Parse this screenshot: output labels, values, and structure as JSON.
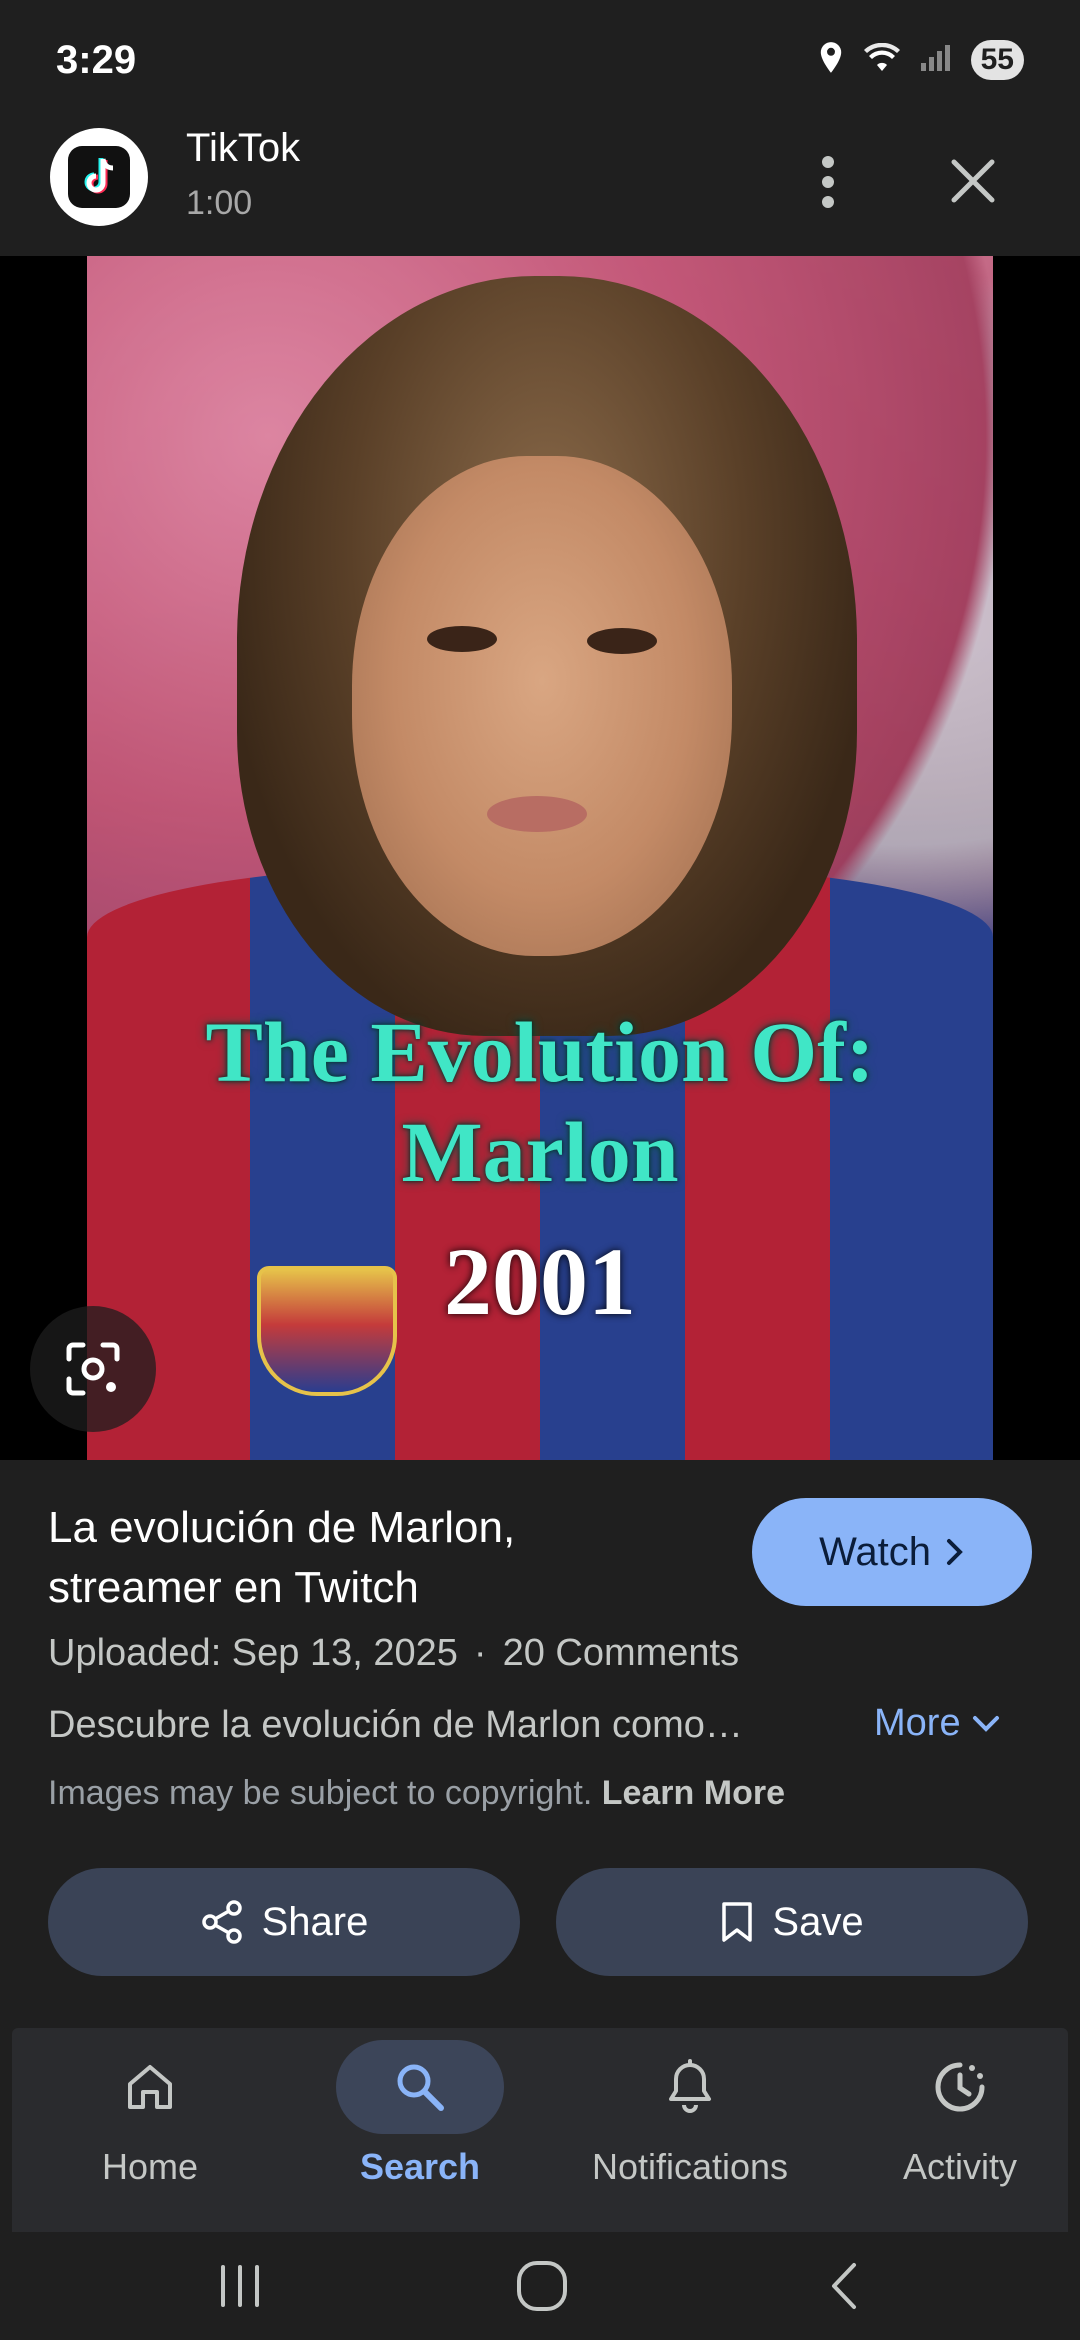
{
  "status_bar": {
    "time": "3:29",
    "battery": "55"
  },
  "header": {
    "source_name": "TikTok",
    "duration": "1:00"
  },
  "thumbnail": {
    "overlay_title_line1": "The Evolution Of:",
    "overlay_title_line2": "Marlon",
    "overlay_year": "2001"
  },
  "result": {
    "title": "La evolución de Marlon, streamer en Twitch",
    "watch_label": "Watch",
    "uploaded": "Uploaded: Sep 13, 2025",
    "separator": "·",
    "comments": "20 Comments",
    "description": "Descubre la evolución de Marlon como…",
    "more_label": "More",
    "copyright_text": "Images may be subject to copyright.",
    "learn_more": "Learn More",
    "share_label": "Share",
    "save_label": "Save"
  },
  "bottom_nav": {
    "items": [
      {
        "label": "Home",
        "icon": "home-icon"
      },
      {
        "label": "Search",
        "icon": "search-icon",
        "active": true
      },
      {
        "label": "Notifications",
        "icon": "bell-icon"
      },
      {
        "label": "Activity",
        "icon": "activity-icon"
      }
    ]
  },
  "colors": {
    "accent": "#8ab4f8",
    "background": "#1f1f1f",
    "button_bg": "#3a4356"
  }
}
